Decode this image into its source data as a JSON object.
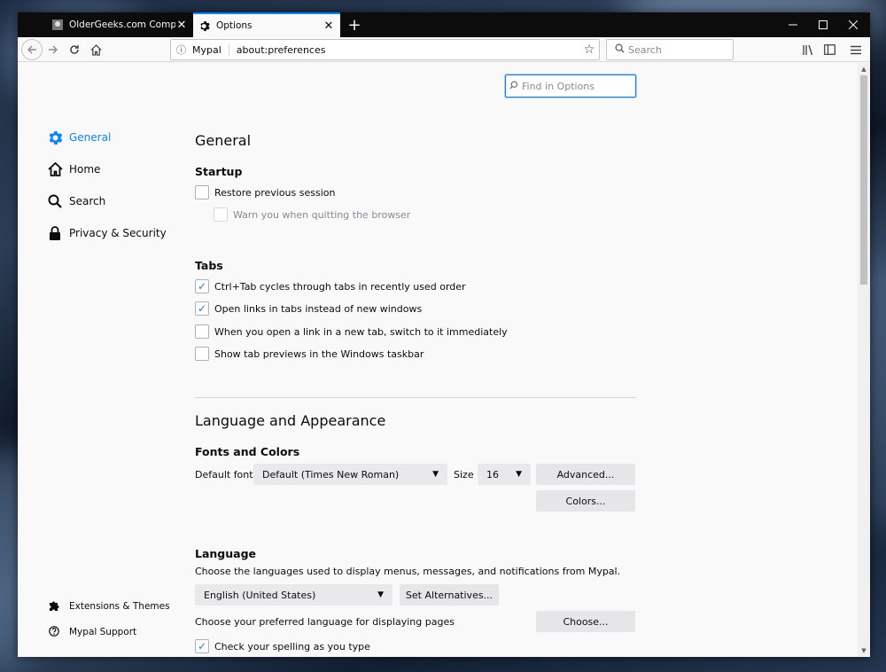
{
  "tabs": [
    {
      "title": "OlderGeeks.com Computer Sof",
      "close": "✕",
      "active": false
    },
    {
      "title": "Options",
      "close": "✕",
      "active": true
    }
  ],
  "newtab": "+",
  "window_controls": {
    "minimize": "—",
    "maximize": "☐",
    "close": "✕"
  },
  "nav": {
    "identity": "Mypal",
    "url": "about:preferences",
    "search_placeholder": "Search"
  },
  "find_placeholder": "Find in Options",
  "categories": [
    {
      "label": "General",
      "icon": "gear-icon",
      "selected": true
    },
    {
      "label": "Home",
      "icon": "home-icon",
      "selected": false
    },
    {
      "label": "Search",
      "icon": "search-icon",
      "selected": false
    },
    {
      "label": "Privacy & Security",
      "icon": "lock-icon",
      "selected": false
    }
  ],
  "bottom_links": [
    {
      "label": "Extensions & Themes",
      "icon": "puzzle-icon"
    },
    {
      "label": "Mypal Support",
      "icon": "help-icon"
    }
  ],
  "general": {
    "title": "General",
    "startup": {
      "heading": "Startup",
      "restore": {
        "label": "Restore previous session",
        "checked": false
      },
      "warn": {
        "label": "Warn you when quitting the browser",
        "checked": false,
        "disabled": true
      }
    },
    "tabs": {
      "heading": "Tabs",
      "items": [
        {
          "label": "Ctrl+Tab cycles through tabs in recently used order",
          "checked": true
        },
        {
          "label": "Open links in tabs instead of new windows",
          "checked": true
        },
        {
          "label": "When you open a link in a new tab, switch to it immediately",
          "checked": false
        },
        {
          "label": "Show tab previews in the Windows taskbar",
          "checked": false
        }
      ]
    }
  },
  "appearance": {
    "title": "Language and Appearance",
    "fonts": {
      "heading": "Fonts and Colors",
      "default_font_label": "Default font",
      "default_font_value": "Default (Times New Roman)",
      "size_label": "Size",
      "size_value": "16",
      "advanced_button": "Advanced...",
      "colors_button": "Colors..."
    },
    "language": {
      "heading": "Language",
      "description": "Choose the languages used to display menus, messages, and notifications from Mypal.",
      "ui_language_value": "English (United States)",
      "set_alternatives_button": "Set Alternatives...",
      "pages_description": "Choose your preferred language for displaying pages",
      "choose_button": "Choose...",
      "spellcheck": {
        "label": "Check your spelling as you type",
        "checked": true
      }
    }
  },
  "colors": {
    "accent": "#0a84ff",
    "tabbar": "#0c0c0d",
    "page": "#f9f9fa"
  }
}
